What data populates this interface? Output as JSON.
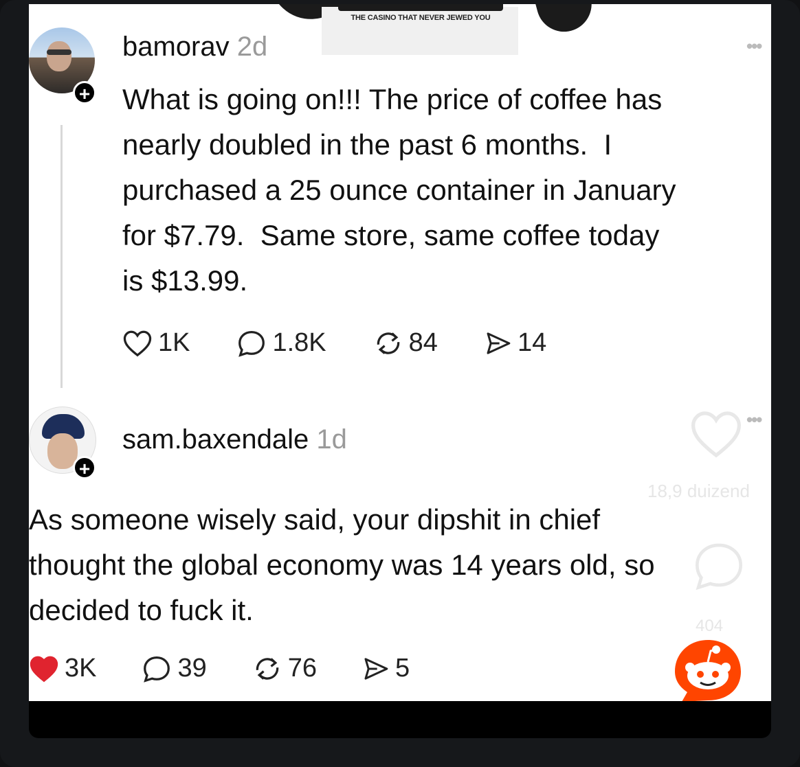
{
  "ad": {
    "tagline": "THE CASINO THAT NEVER JEWED YOU"
  },
  "posts": [
    {
      "username": "bamorav",
      "time": "2d",
      "text": "What is going on!!! The price of coffee has\nnearly doubled in the past 6 months.  I\npurchased a 25 ounce container in January\nfor $7.79.  Same store, same coffee today\nis $13.99.",
      "likes": "1K",
      "replies": "1.8K",
      "reposts": "84",
      "shares": "14",
      "liked": false
    },
    {
      "username": "sam.baxendale",
      "time": "1d",
      "text": "As someone wisely said, your dipshit in chief\nthought the global economy was 14 years old, so\ndecided to fuck it.",
      "likes": "3K",
      "replies": "39",
      "reposts": "76",
      "shares": "5",
      "liked": true
    }
  ],
  "watermark": {
    "text": "18,9 duizend",
    "count": "404"
  },
  "colors": {
    "like_red": "#e0242f",
    "reddit_orange": "#ff4500",
    "text": "#111111",
    "muted": "#9a9a9a"
  },
  "icons": [
    "heart-icon",
    "comment-icon",
    "repost-icon",
    "share-icon",
    "more-icon",
    "follow-plus-icon",
    "reddit-logo"
  ]
}
